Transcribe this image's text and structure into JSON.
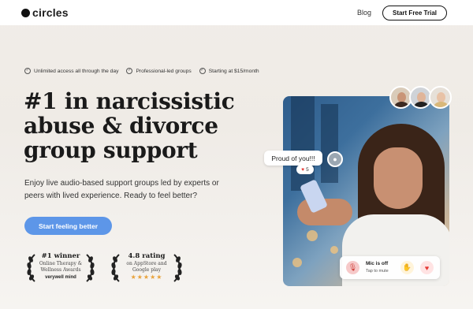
{
  "header": {
    "logo_text": "circles",
    "blog_label": "Blog",
    "trial_button": "Start Free Trial"
  },
  "features": [
    {
      "label": "Unlimited access all through the day",
      "icon": "check-circle-icon"
    },
    {
      "label": "Professional-led groups",
      "icon": "check-circle-icon"
    },
    {
      "label": "Starting at $15/month",
      "icon": "check-circle-icon"
    }
  ],
  "hero": {
    "title_lines": [
      "#1 in narcissistic",
      "abuse & divorce",
      "group support"
    ],
    "subtitle": "Enjoy live audio-based support groups led by experts or peers with lived experience. Ready to feel better?",
    "cta_label": "Start feeling better"
  },
  "awards": [
    {
      "title": "#1 winner",
      "lines": [
        "Online Therapy &",
        "Wellness Awards"
      ],
      "brand": "verywell mind"
    },
    {
      "title": "4.8 rating",
      "lines": [
        "on AppStore and",
        "Google play"
      ],
      "stars": "★★★★★"
    }
  ],
  "chat": {
    "bubble_text": "Proud of you!!!",
    "reaction_count": "5"
  },
  "mic": {
    "title": "Mic is off",
    "subtitle": "Tap to mute"
  },
  "colors": {
    "accent": "#5d96e8",
    "star": "#e8a23b",
    "heart": "#e53935"
  }
}
